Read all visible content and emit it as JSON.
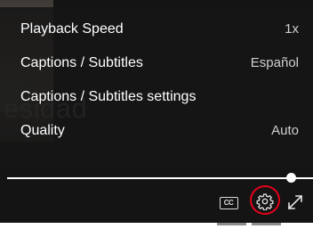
{
  "settings_menu": {
    "items": [
      {
        "label": "Playback Speed",
        "value": "1x"
      },
      {
        "label": "Captions / Subtitles",
        "value": "Español"
      },
      {
        "label": "Captions / Subtitles settings",
        "value": ""
      },
      {
        "label": "Quality",
        "value": "Auto"
      }
    ]
  },
  "video": {
    "background_text": "esidad"
  },
  "controls": {
    "progress_fraction": 0.93,
    "cc_label": "CC",
    "icons": {
      "captions": "closed-captions-icon",
      "settings": "gear-icon",
      "fullscreen": "expand-diagonal-icon"
    },
    "highlight_color": "#e3001b"
  }
}
